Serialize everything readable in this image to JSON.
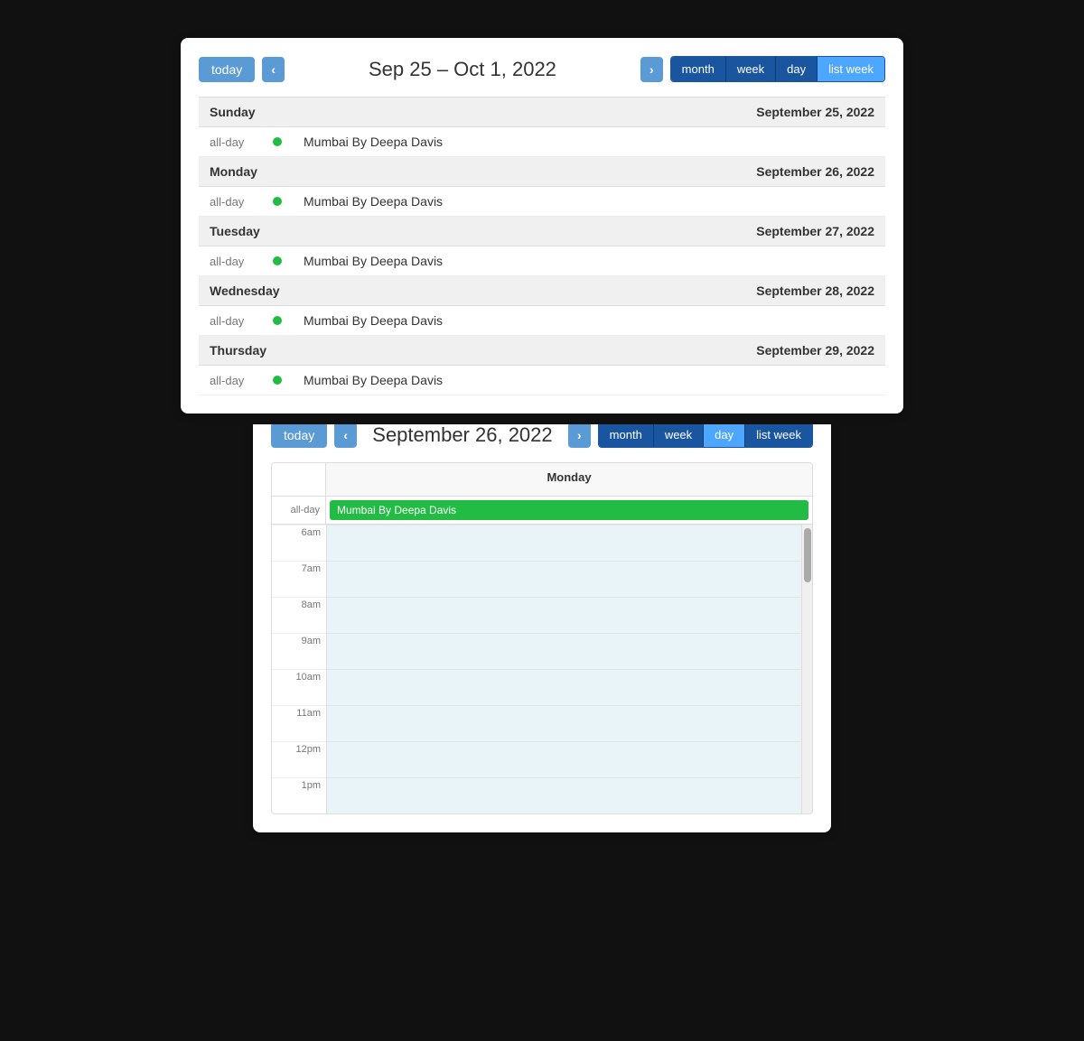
{
  "top_calendar": {
    "today_label": "today",
    "prev_label": "‹",
    "next_label": "›",
    "date_range": "Sep 25 – Oct 1, 2022",
    "views": [
      "month",
      "week",
      "day",
      "list week"
    ],
    "active_view": "list week",
    "days": [
      {
        "day_name": "Sunday",
        "day_date": "September 25, 2022",
        "events": [
          {
            "time": "all-day",
            "title": "Mumbai By Deepa Davis"
          }
        ]
      },
      {
        "day_name": "Monday",
        "day_date": "September 26, 2022",
        "events": [
          {
            "time": "all-day",
            "title": "Mumbai By Deepa Davis"
          }
        ]
      },
      {
        "day_name": "Tuesday",
        "day_date": "September 27, 2022",
        "events": [
          {
            "time": "all-day",
            "title": "Mumbai By Deepa Davis"
          }
        ]
      },
      {
        "day_name": "Wednesday",
        "day_date": "September 28, 2022",
        "events": [
          {
            "time": "all-day",
            "title": "Mumbai By Deepa Davis"
          }
        ]
      },
      {
        "day_name": "Thursday",
        "day_date": "September 29, 2022",
        "events": [
          {
            "time": "all-day",
            "title": "Mumbai By Deepa Davis"
          }
        ]
      }
    ]
  },
  "bottom_calendar": {
    "today_label": "today",
    "prev_label": "‹",
    "next_label": "›",
    "date_title": "September 26, 2022",
    "views": [
      "month",
      "week",
      "day",
      "list week"
    ],
    "active_view": "day",
    "col_header": "Monday",
    "allday_label": "all-day",
    "allday_event": "Mumbai By Deepa Davis",
    "time_slots": [
      "6am",
      "7am",
      "8am",
      "9am",
      "10am",
      "11am",
      "12pm",
      "1pm"
    ]
  }
}
